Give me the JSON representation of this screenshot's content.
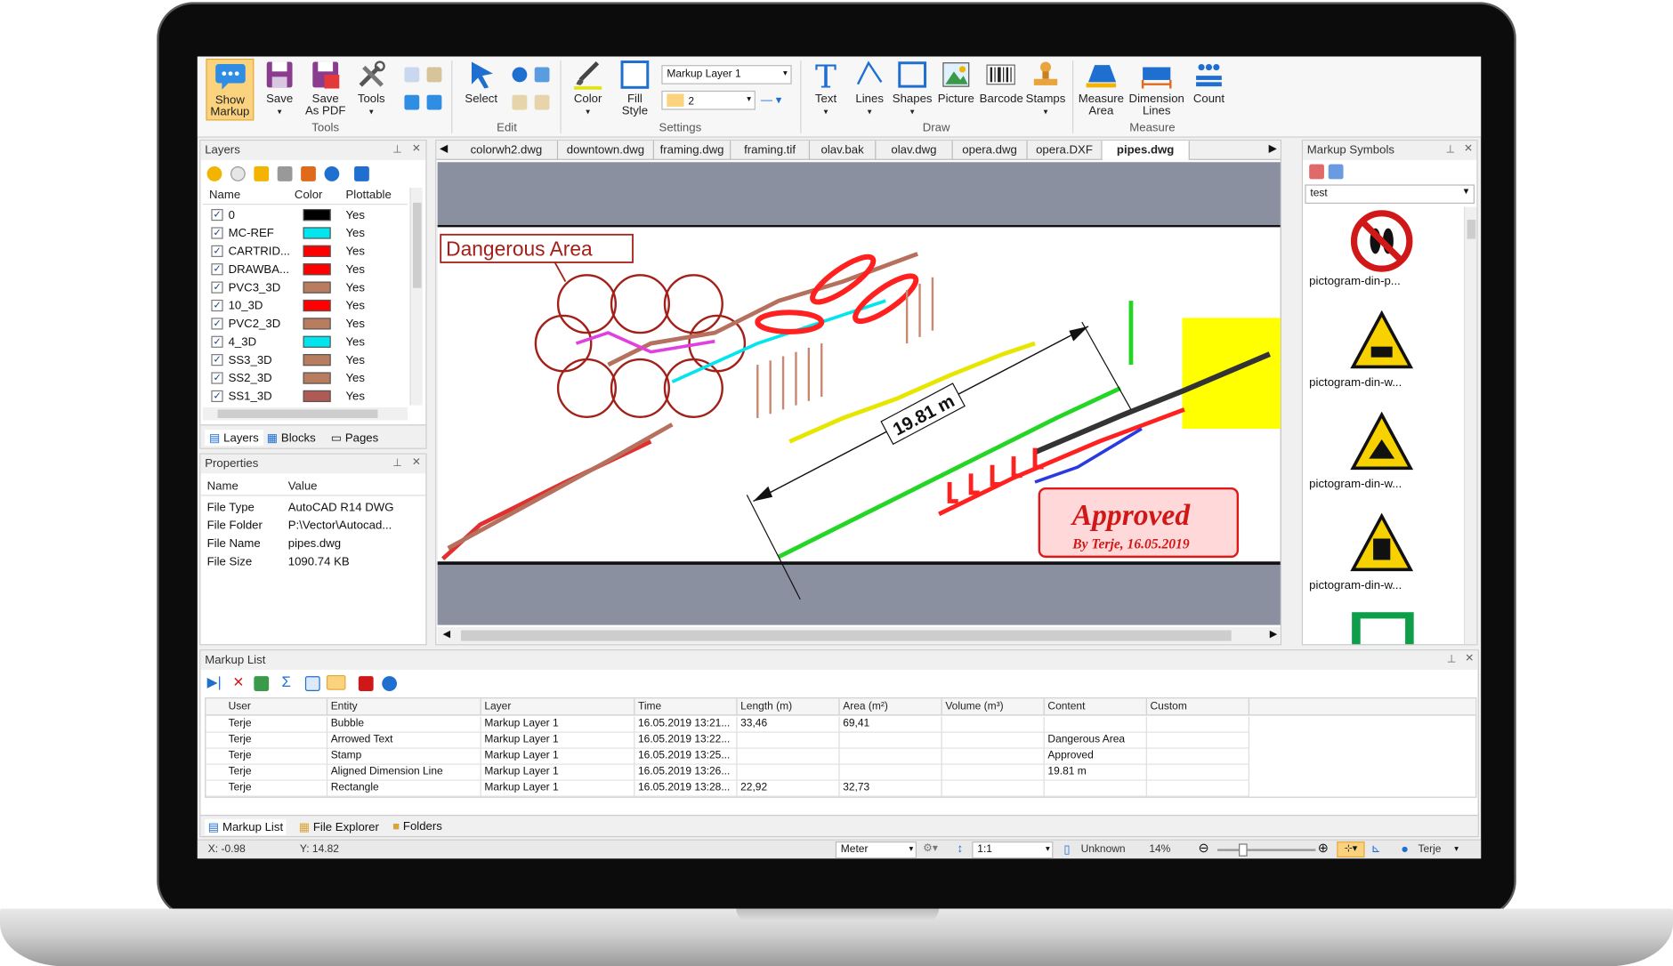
{
  "ribbon": {
    "tools": {
      "show_markup": "Show\nMarkup",
      "save": "Save",
      "save_pdf": "Save\nAs PDF",
      "tools": "Tools",
      "group": "Tools"
    },
    "edit": {
      "select": "Select",
      "group": "Edit"
    },
    "settings": {
      "color": "Color",
      "fill_style": "Fill\nStyle",
      "layer_combo": "Markup Layer 1",
      "width_combo": "2",
      "group": "Settings"
    },
    "draw": {
      "text": "Text",
      "lines": "Lines",
      "shapes": "Shapes",
      "picture": "Picture",
      "barcode": "Barcode",
      "stamps": "Stamps",
      "group": "Draw"
    },
    "measure": {
      "measure_area": "Measure\nArea",
      "dimension_lines": "Dimension\nLines",
      "count": "Count",
      "group": "Measure"
    }
  },
  "layers_panel": {
    "title": "Layers",
    "columns": [
      "Name",
      "Color",
      "Plottable"
    ],
    "rows": [
      {
        "name": "0",
        "color": "#000000",
        "plottable": "Yes"
      },
      {
        "name": "MC-REF",
        "color": "#00e5ee",
        "plottable": "Yes"
      },
      {
        "name": "CARTRID...",
        "color": "#ff0000",
        "plottable": "Yes"
      },
      {
        "name": "DRAWBA...",
        "color": "#ff0000",
        "plottable": "Yes"
      },
      {
        "name": "PVC3_3D",
        "color": "#b77d5e",
        "plottable": "Yes"
      },
      {
        "name": "10_3D",
        "color": "#ff0000",
        "plottable": "Yes"
      },
      {
        "name": "PVC2_3D",
        "color": "#b77d5e",
        "plottable": "Yes"
      },
      {
        "name": "4_3D",
        "color": "#00e5ee",
        "plottable": "Yes"
      },
      {
        "name": "SS3_3D",
        "color": "#b77d5e",
        "plottable": "Yes"
      },
      {
        "name": "SS2_3D",
        "color": "#b77d5e",
        "plottable": "Yes"
      },
      {
        "name": "SS1_3D",
        "color": "#b05a55",
        "plottable": "Yes"
      }
    ],
    "tabs": [
      "Layers",
      "Blocks",
      "Pages"
    ]
  },
  "properties_panel": {
    "title": "Properties",
    "columns": [
      "Name",
      "Value"
    ],
    "rows": [
      {
        "name": "File Type",
        "value": "AutoCAD R14 DWG"
      },
      {
        "name": "File Folder",
        "value": "P:\\Vector\\Autocad..."
      },
      {
        "name": "File Name",
        "value": "pipes.dwg"
      },
      {
        "name": "File Size",
        "value": "1090.74 KB"
      }
    ]
  },
  "doc_tabs": [
    "colorwh2.dwg",
    "downtown.dwg",
    "framing.dwg",
    "framing.tif",
    "olav.bak",
    "olav.dwg",
    "opera.dwg",
    "opera.DXF",
    "pipes.dwg"
  ],
  "drawing": {
    "callout": "Dangerous Area",
    "dimension": "19.81 m",
    "stamp_title": "Approved",
    "stamp_sub": "By Terje, 16.05.2019"
  },
  "symbols_panel": {
    "title": "Markup Symbols",
    "combo": "test",
    "items": [
      "pictogram-din-p...",
      "pictogram-din-w...",
      "pictogram-din-w...",
      "pictogram-din-w..."
    ]
  },
  "markup_list": {
    "title": "Markup List",
    "columns": [
      "User",
      "Entity",
      "Layer",
      "Time",
      "Length (m)",
      "Area (m²)",
      "Volume (m³)",
      "Content",
      "Custom"
    ],
    "rows": [
      [
        "Terje",
        "Bubble",
        "Markup Layer 1",
        "16.05.2019 13:21...",
        "33,46",
        "69,41",
        "",
        "",
        ""
      ],
      [
        "Terje",
        "Arrowed Text",
        "Markup Layer 1",
        "16.05.2019 13:22...",
        "",
        "",
        "",
        "Dangerous Area",
        ""
      ],
      [
        "Terje",
        "Stamp",
        "Markup Layer 1",
        "16.05.2019 13:25...",
        "",
        "",
        "",
        "Approved",
        ""
      ],
      [
        "Terje",
        "Aligned Dimension Line",
        "Markup Layer 1",
        "16.05.2019 13:26...",
        "",
        "",
        "",
        "19.81 m",
        ""
      ],
      [
        "Terje",
        "Rectangle",
        "Markup Layer 1",
        "16.05.2019 13:28...",
        "22,92",
        "32,73",
        "",
        "",
        ""
      ]
    ],
    "tabs": [
      "Markup List",
      "File Explorer",
      "Folders"
    ]
  },
  "statusbar": {
    "x": "X: -0.98",
    "y": "Y: 14.82",
    "unit": "Meter",
    "scale": "1:1",
    "unknown": "Unknown",
    "zoom": "14%",
    "user": "Terje"
  }
}
